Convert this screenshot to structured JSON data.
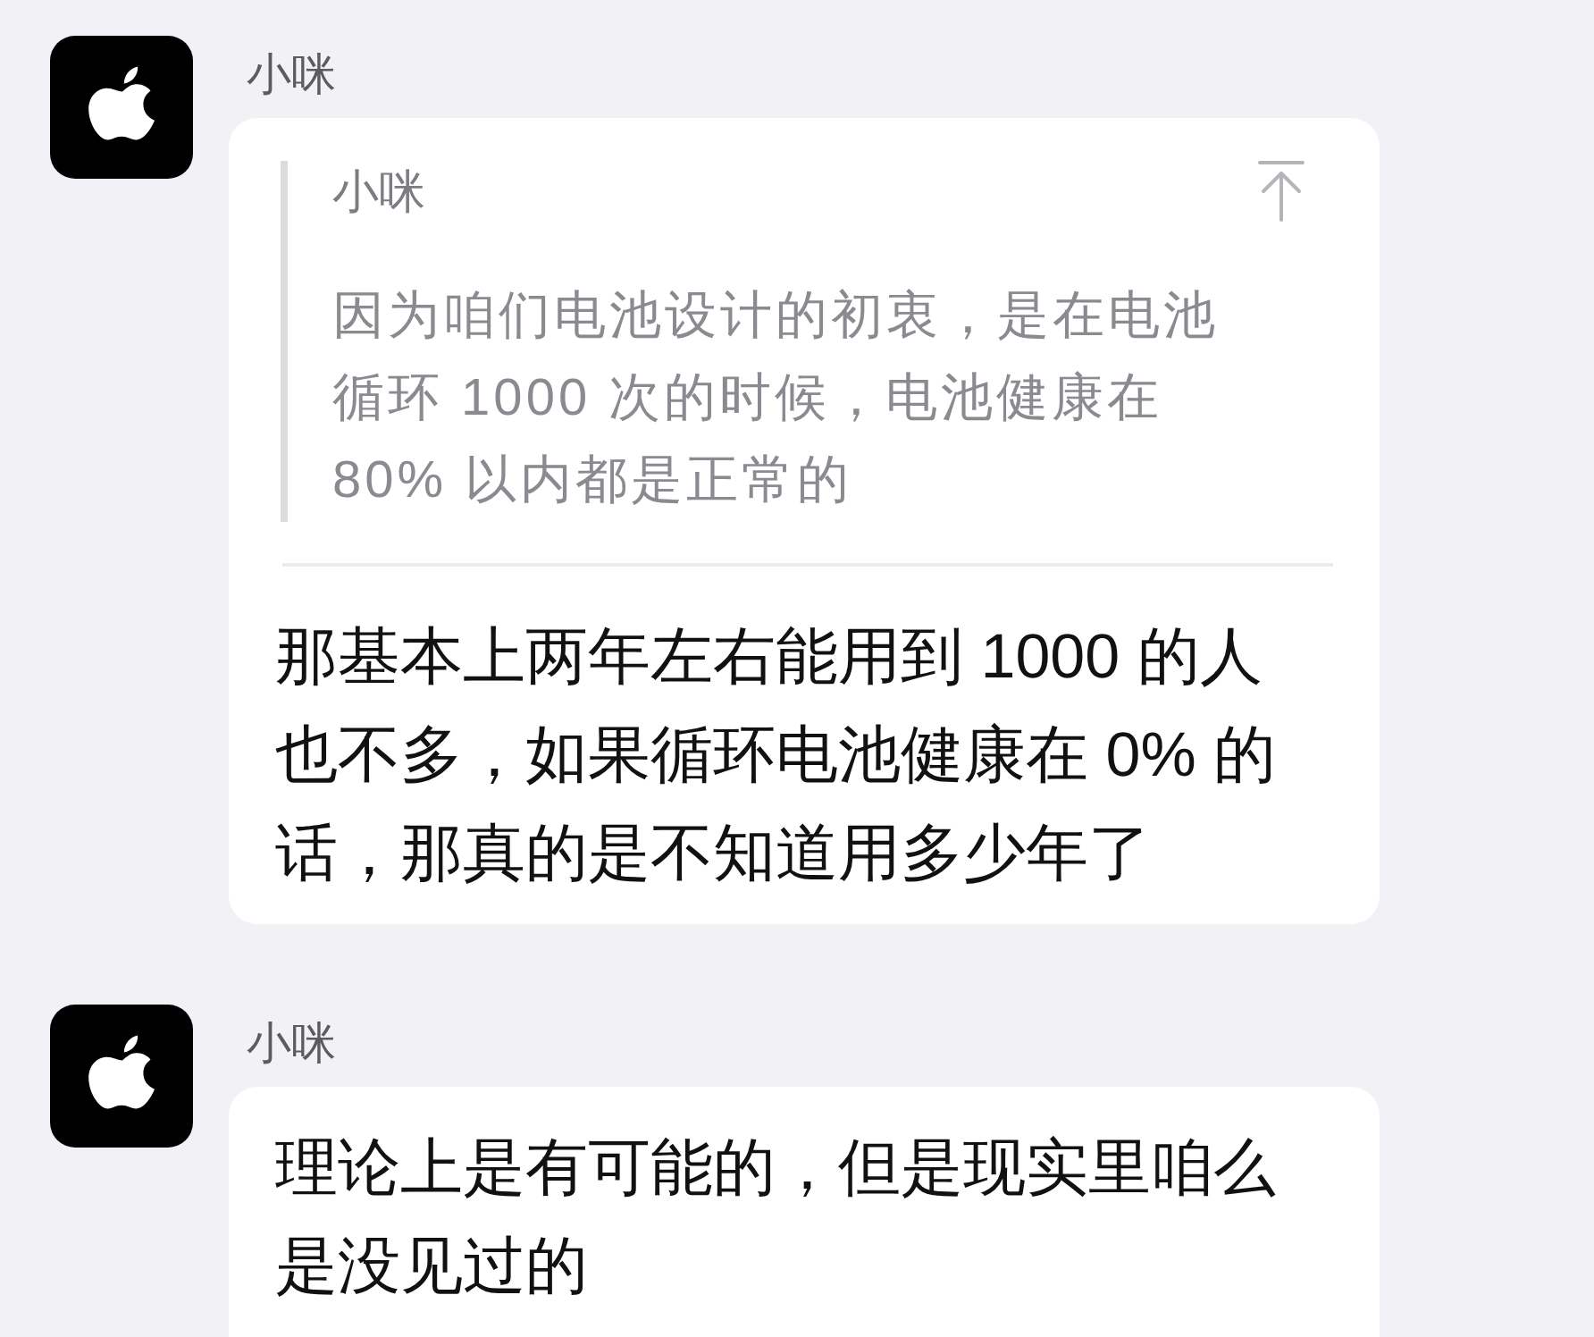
{
  "messages": [
    {
      "sender": "小咪",
      "quote": {
        "sender": "小咪",
        "text": "因为咱们电池设计的初衷，是在电池循环 1000 次的时候，电池健康在 80% 以内都是正常的"
      },
      "text": "那基本上两年左右能用到 1000 的人也不多，如果循环电池健康在 0% 的话，那真的是不知道用多少年了"
    },
    {
      "sender": "小咪",
      "text": "理论上是有可能的，但是现实里咱么是没见过的"
    }
  ]
}
